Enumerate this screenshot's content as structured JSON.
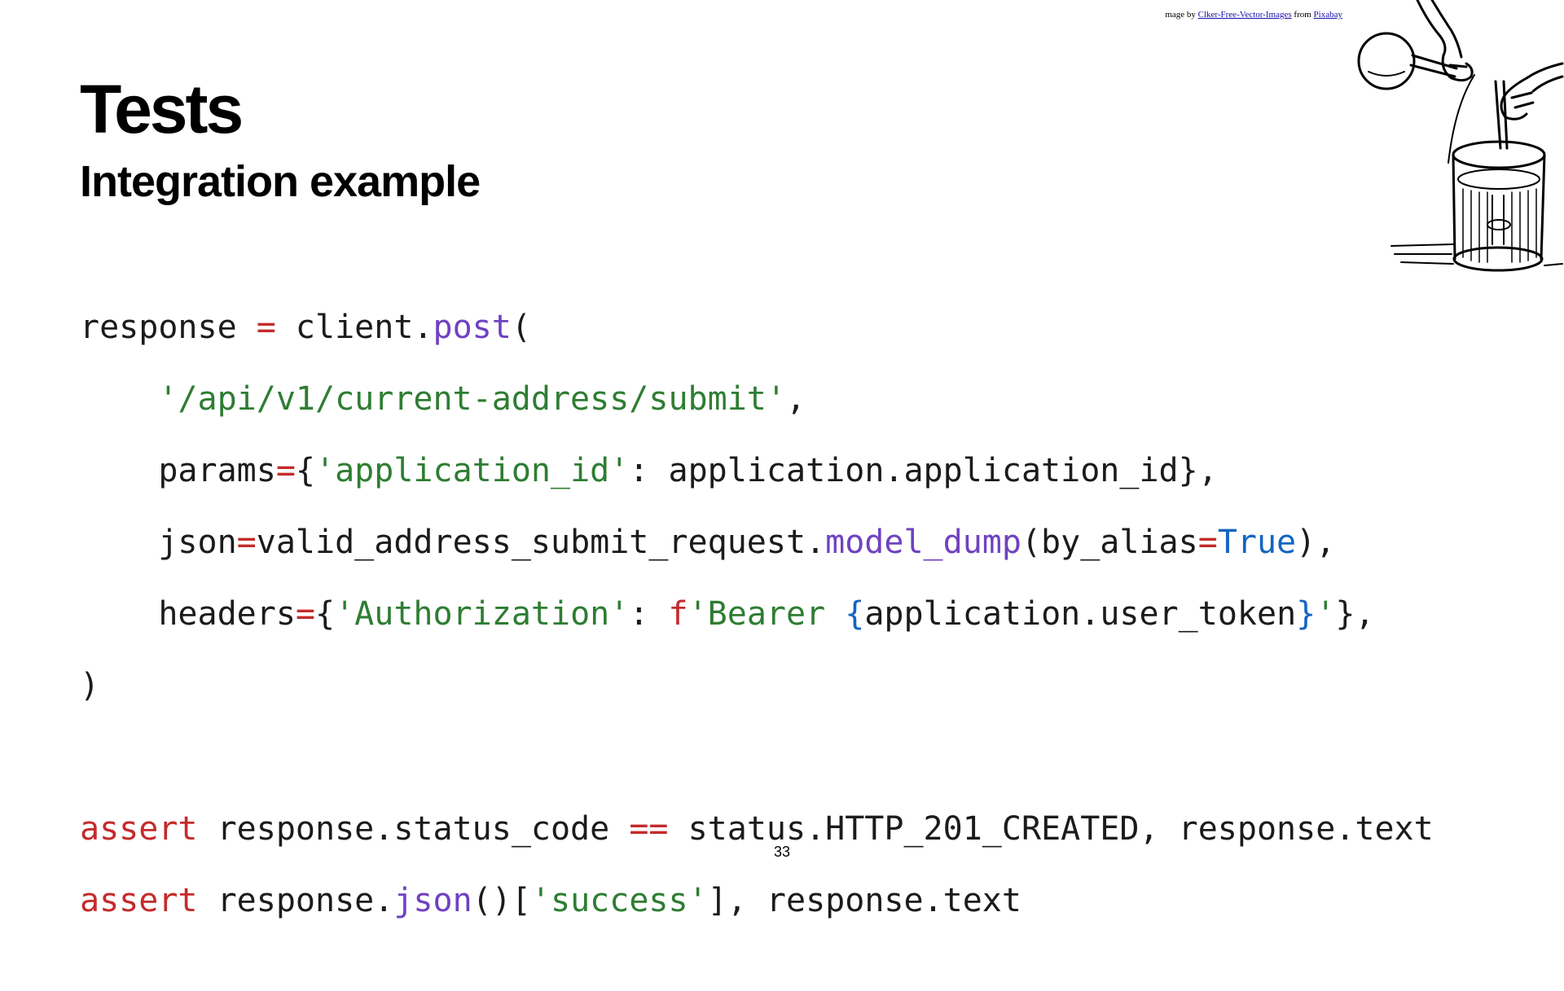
{
  "slide": {
    "title": "Tests",
    "subtitle": "Integration example",
    "page_number": "33"
  },
  "credit": {
    "prefix": "mage by ",
    "author": "Clker-Free-Vector-Images",
    "middle": " from ",
    "source": "Pixabay"
  },
  "illustration": {
    "icon": "chemist-pouring-liquid-icon"
  },
  "code": {
    "l1": [
      "response",
      " = ",
      "client",
      ".",
      "post",
      "("
    ],
    "l2": [
      "    ",
      "'/api/v1/current-address/submit'",
      ","
    ],
    "l3": [
      "    ",
      "params",
      "=",
      "{",
      "'application_id'",
      ": application.application_id},"
    ],
    "l4": [
      "    ",
      "json",
      "=",
      "valid_address_submit_request.",
      "model_dump",
      "(by_alias",
      "=",
      "True",
      "),"
    ],
    "l5": [
      "    ",
      "headers",
      "=",
      "{",
      "'Authorization'",
      ": ",
      "f",
      "'Bearer ",
      "{",
      "application.user_token",
      "}",
      "'",
      "},"
    ],
    "l6": [
      ")"
    ],
    "l7": [
      ""
    ],
    "l8": [
      "assert",
      " response.status_code ",
      "==",
      " status.HTTP_201_CREATED, response.text"
    ],
    "l9": [
      "assert",
      " response.",
      "json",
      "()[",
      "'success'",
      "], response.text"
    ]
  },
  "colors": {
    "keyword": "#c42b2b",
    "string": "#2e7d32",
    "function": "#6f42c1",
    "constant": "#1565c0"
  }
}
